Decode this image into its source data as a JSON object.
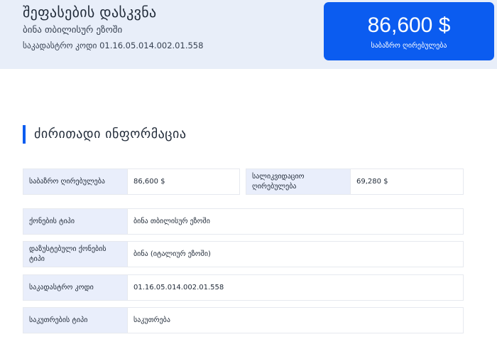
{
  "header": {
    "title": "შეფასების დასკვნა",
    "subtitle": "ბინა თბილისურ ეზოში",
    "cadastral_line": "საკადასტრო კოდი 01.16.05.014.002.01.558"
  },
  "price_card": {
    "value": "86,600 $",
    "label": "საბაზრო ღირებულება"
  },
  "section": {
    "title": "ძირითადი ინფორმაცია"
  },
  "info": {
    "market_value": {
      "label": "საბაზრო ღირებულება",
      "value": "86,600 $"
    },
    "liquidation_value": {
      "label": "სალიკვიდაციო ღირებულება",
      "value": "69,280 $"
    },
    "property_type": {
      "label": "ქონების ტიპი",
      "value": "ბინა თბილისურ ეზოში"
    },
    "specified_type": {
      "label": "დაზუსტებული ქონების ტიპი",
      "value": "ბინა (იტალიურ ეზოში)"
    },
    "cadastral_code": {
      "label": "საკადასტრო კოდი",
      "value": "01.16.05.014.002.01.558"
    },
    "ownership_type": {
      "label": "საკუთრების ტიპი",
      "value": "საკუთრება"
    }
  }
}
